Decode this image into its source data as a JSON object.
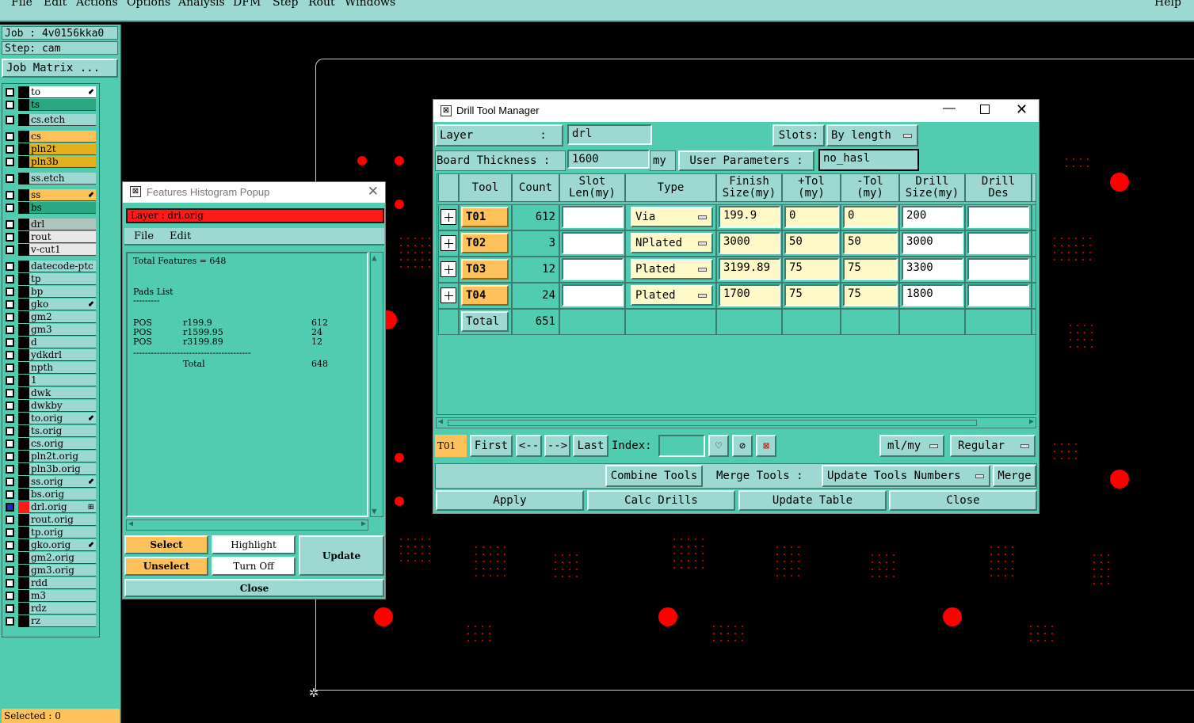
{
  "menubar": {
    "items": [
      "File",
      "Edit",
      "Actions",
      "Options",
      "Analysis",
      "DFM",
      "Step",
      "Rout",
      "Windows"
    ],
    "help": "Help"
  },
  "left": {
    "job": "Job : 4v0156kka0",
    "step": "Step: cam",
    "job_matrix": "Job Matrix ...",
    "selected": "Selected : 0",
    "layers": [
      {
        "name": "to",
        "color": "#ffffff",
        "mark": "⬋"
      },
      {
        "name": "ts",
        "color": "#2aa882",
        "mark": ""
      },
      {
        "name": "cs.etch",
        "color": "#9dd9d2",
        "mark": ""
      },
      {
        "name": "cs",
        "color": "#ffc25a",
        "mark": ""
      },
      {
        "name": "pln2t",
        "color": "#e2b020",
        "mark": ""
      },
      {
        "name": "pln3b",
        "color": "#e2b020",
        "mark": ""
      },
      {
        "name": "ss.etch",
        "color": "#9dd9d2",
        "mark": ""
      },
      {
        "name": "ss",
        "color": "#ffc25a",
        "mark": "⬋"
      },
      {
        "name": "bs",
        "color": "#2aa882",
        "mark": ""
      },
      {
        "name": "drl",
        "color": "#b0c4c0",
        "mark": ""
      },
      {
        "name": "rout",
        "color": "#e8e8e8",
        "mark": ""
      },
      {
        "name": "v-cut1",
        "color": "#e8e8e8",
        "mark": ""
      },
      {
        "name": "datecode-ptc",
        "color": "#9dd9d2",
        "mark": ""
      },
      {
        "name": "tp",
        "color": "#9dd9d2",
        "mark": ""
      },
      {
        "name": "bp",
        "color": "#9dd9d2",
        "mark": ""
      },
      {
        "name": "gko",
        "color": "#9dd9d2",
        "mark": "⬋"
      },
      {
        "name": "gm2",
        "color": "#9dd9d2",
        "mark": ""
      },
      {
        "name": "gm3",
        "color": "#9dd9d2",
        "mark": ""
      },
      {
        "name": "d",
        "color": "#9dd9d2",
        "mark": ""
      },
      {
        "name": "ydkdrl",
        "color": "#9dd9d2",
        "mark": ""
      },
      {
        "name": "npth",
        "color": "#9dd9d2",
        "mark": ""
      },
      {
        "name": "1",
        "color": "#9dd9d2",
        "mark": ""
      },
      {
        "name": "dwk",
        "color": "#9dd9d2",
        "mark": ""
      },
      {
        "name": "dwkby",
        "color": "#9dd9d2",
        "mark": ""
      },
      {
        "name": "to.orig",
        "color": "#9dd9d2",
        "mark": "⬋"
      },
      {
        "name": "ts.orig",
        "color": "#9dd9d2",
        "mark": ""
      },
      {
        "name": "cs.orig",
        "color": "#9dd9d2",
        "mark": ""
      },
      {
        "name": "pln2t.orig",
        "color": "#9dd9d2",
        "mark": ""
      },
      {
        "name": "pln3b.orig",
        "color": "#9dd9d2",
        "mark": ""
      },
      {
        "name": "ss.orig",
        "color": "#9dd9d2",
        "mark": "⬋"
      },
      {
        "name": "bs.orig",
        "color": "#9dd9d2",
        "mark": ""
      },
      {
        "name": "drl.orig",
        "color": "#9dd9d2",
        "mark": "⊞"
      },
      {
        "name": "rout.orig",
        "color": "#9dd9d2",
        "mark": ""
      },
      {
        "name": "tp.orig",
        "color": "#9dd9d2",
        "mark": ""
      },
      {
        "name": "gko.orig",
        "color": "#9dd9d2",
        "mark": "⬋"
      },
      {
        "name": "gm2.orig",
        "color": "#9dd9d2",
        "mark": ""
      },
      {
        "name": "gm3.orig",
        "color": "#9dd9d2",
        "mark": ""
      },
      {
        "name": "rdd",
        "color": "#9dd9d2",
        "mark": ""
      },
      {
        "name": "m3",
        "color": "#9dd9d2",
        "mark": ""
      },
      {
        "name": "rdz",
        "color": "#9dd9d2",
        "mark": ""
      },
      {
        "name": "rz",
        "color": "#9dd9d2",
        "mark": ""
      }
    ]
  },
  "features": {
    "title": "Features Histogram Popup",
    "layer": "Layer :  drl.orig",
    "menu_file": "File",
    "menu_edit": "Edit",
    "total_features": "Total Features = 648",
    "pads_list": "Pads List",
    "pads_under": "---------",
    "rows": [
      {
        "kind": "POS",
        "sym": "r199.9",
        "count": "612"
      },
      {
        "kind": "POS",
        "sym": "r1599.95",
        "count": "24"
      },
      {
        "kind": "POS",
        "sym": "r3199.89",
        "count": "12"
      }
    ],
    "sep": "----------------------------------------",
    "total_label": "Total",
    "total_value": "648",
    "btn_select": "Select",
    "btn_unselect": "Unselect",
    "btn_highlight": "Highlight",
    "btn_turnoff": "Turn Off",
    "btn_update": "Update",
    "btn_close": "Close"
  },
  "dtm": {
    "title": "Drill Tool Manager",
    "layer_label": "Layer          :",
    "layer_value": "drl",
    "slots_label": "Slots:",
    "slots_value": "By length",
    "board_thickness_label": "Board Thickness :",
    "board_thickness_value": "1600",
    "unit": "my",
    "user_params": "User Parameters :",
    "user_params_value": "no_hasl",
    "headers": [
      {
        "l1": "Tool",
        "l2": ""
      },
      {
        "l1": "Count",
        "l2": ""
      },
      {
        "l1": "Slot",
        "l2": "Len(my)"
      },
      {
        "l1": "Type",
        "l2": ""
      },
      {
        "l1": "Finish",
        "l2": "Size(my)"
      },
      {
        "l1": "+Tol",
        "l2": "(my)"
      },
      {
        "l1": "-Tol",
        "l2": "(my)"
      },
      {
        "l1": "Drill",
        "l2": "Size(my)"
      },
      {
        "l1": "Drill",
        "l2": "Des"
      }
    ],
    "rows": [
      {
        "tool": "T01",
        "count": "612",
        "slot": "",
        "type": "Via",
        "finish": "199.9",
        "ptol": "0",
        "ntol": "0",
        "drill": "200",
        "des": ""
      },
      {
        "tool": "T02",
        "count": "3",
        "slot": "",
        "type": "NPlated",
        "finish": "3000",
        "ptol": "50",
        "ntol": "50",
        "drill": "3000",
        "des": ""
      },
      {
        "tool": "T03",
        "count": "12",
        "slot": "",
        "type": "Plated",
        "finish": "3199.89",
        "ptol": "75",
        "ntol": "75",
        "drill": "3300",
        "des": ""
      },
      {
        "tool": "T04",
        "count": "24",
        "slot": "",
        "type": "Plated",
        "finish": "1700",
        "ptol": "75",
        "ntol": "75",
        "drill": "1800",
        "des": ""
      }
    ],
    "total_label": "Total",
    "total_value": "651",
    "current_tool": "T01",
    "nav_first": "First",
    "nav_prev": "<--",
    "nav_next": "-->",
    "nav_last": "Last",
    "index_label": "Index:",
    "units_value": "ml/my",
    "mode_value": "Regular",
    "combine_tools": "Combine Tools",
    "merge_tools_label": "Merge Tools :",
    "update_numbers": "Update Tools Numbers",
    "merge": "Merge",
    "apply": "Apply",
    "calc_drills": "Calc Drills",
    "update_table": "Update Table",
    "close": "Close"
  }
}
